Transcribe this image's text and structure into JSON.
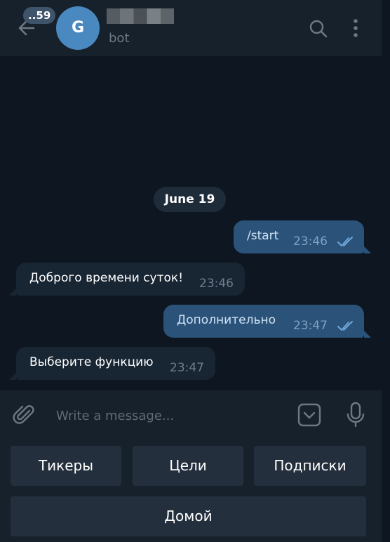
{
  "header": {
    "unread_count": "..59",
    "avatar_letter": "G",
    "subtitle": "bot"
  },
  "chat": {
    "date": "June 19",
    "messages": [
      {
        "direction": "out",
        "text": "/start",
        "time": "23:46",
        "read": true
      },
      {
        "direction": "in",
        "text": "Доброго времени суток!",
        "time": "23:46"
      },
      {
        "direction": "out",
        "text": "Дополнительно",
        "time": "23:47",
        "read": true
      },
      {
        "direction": "in",
        "text": "Выберите функцию",
        "time": "23:47"
      }
    ]
  },
  "composer": {
    "placeholder": "Write a message..."
  },
  "bot_keyboard": {
    "row1": [
      "Тикеры",
      "Цели",
      "Подписки"
    ],
    "row2": [
      "Домой"
    ]
  },
  "colors": {
    "background": "#0e1621",
    "panel": "#17212b",
    "outgoing_bubble": "#2b5278",
    "incoming_bubble": "#182533",
    "accent": "#4a88c0"
  },
  "icons": [
    "back-arrow-icon",
    "search-icon",
    "more-vertical-icon",
    "paperclip-icon",
    "bot-keyboard-icon",
    "microphone-icon",
    "double-check-icon"
  ]
}
